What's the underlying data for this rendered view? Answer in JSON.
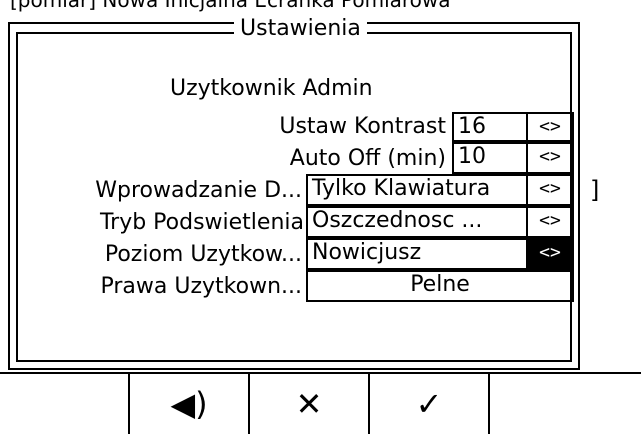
{
  "top_text": "[pomiar] Nowa Inicjalna Ecranka Pomiarowa",
  "dialog": {
    "title": "Ustawienia",
    "user_line": "Uzytkownik Admin",
    "rows": [
      {
        "label": "Ustaw Kontrast",
        "value": "16",
        "arrow": "<>"
      },
      {
        "label": "Auto Off (min)",
        "value": "10",
        "arrow": "<>"
      },
      {
        "label": "Wprowadzanie D...",
        "value": "Tylko Klawiatura",
        "arrow": "<>"
      },
      {
        "label": "Tryb Podswietlenia",
        "value": "Oszczednosc ...",
        "arrow": "<>"
      },
      {
        "label": "Poziom Uzytkow...",
        "value": "Nowicjusz",
        "arrow": "<>"
      },
      {
        "label": "Prawa Uzytkown...",
        "value": "Pelne"
      }
    ]
  },
  "right_mark": "]",
  "softkeys": [
    {
      "name": "empty-softkey-1",
      "icon": ""
    },
    {
      "name": "sound-icon",
      "icon": "◀)"
    },
    {
      "name": "close-icon",
      "icon": "✕"
    },
    {
      "name": "check-icon",
      "icon": "✓"
    },
    {
      "name": "empty-softkey-5",
      "icon": ""
    }
  ]
}
